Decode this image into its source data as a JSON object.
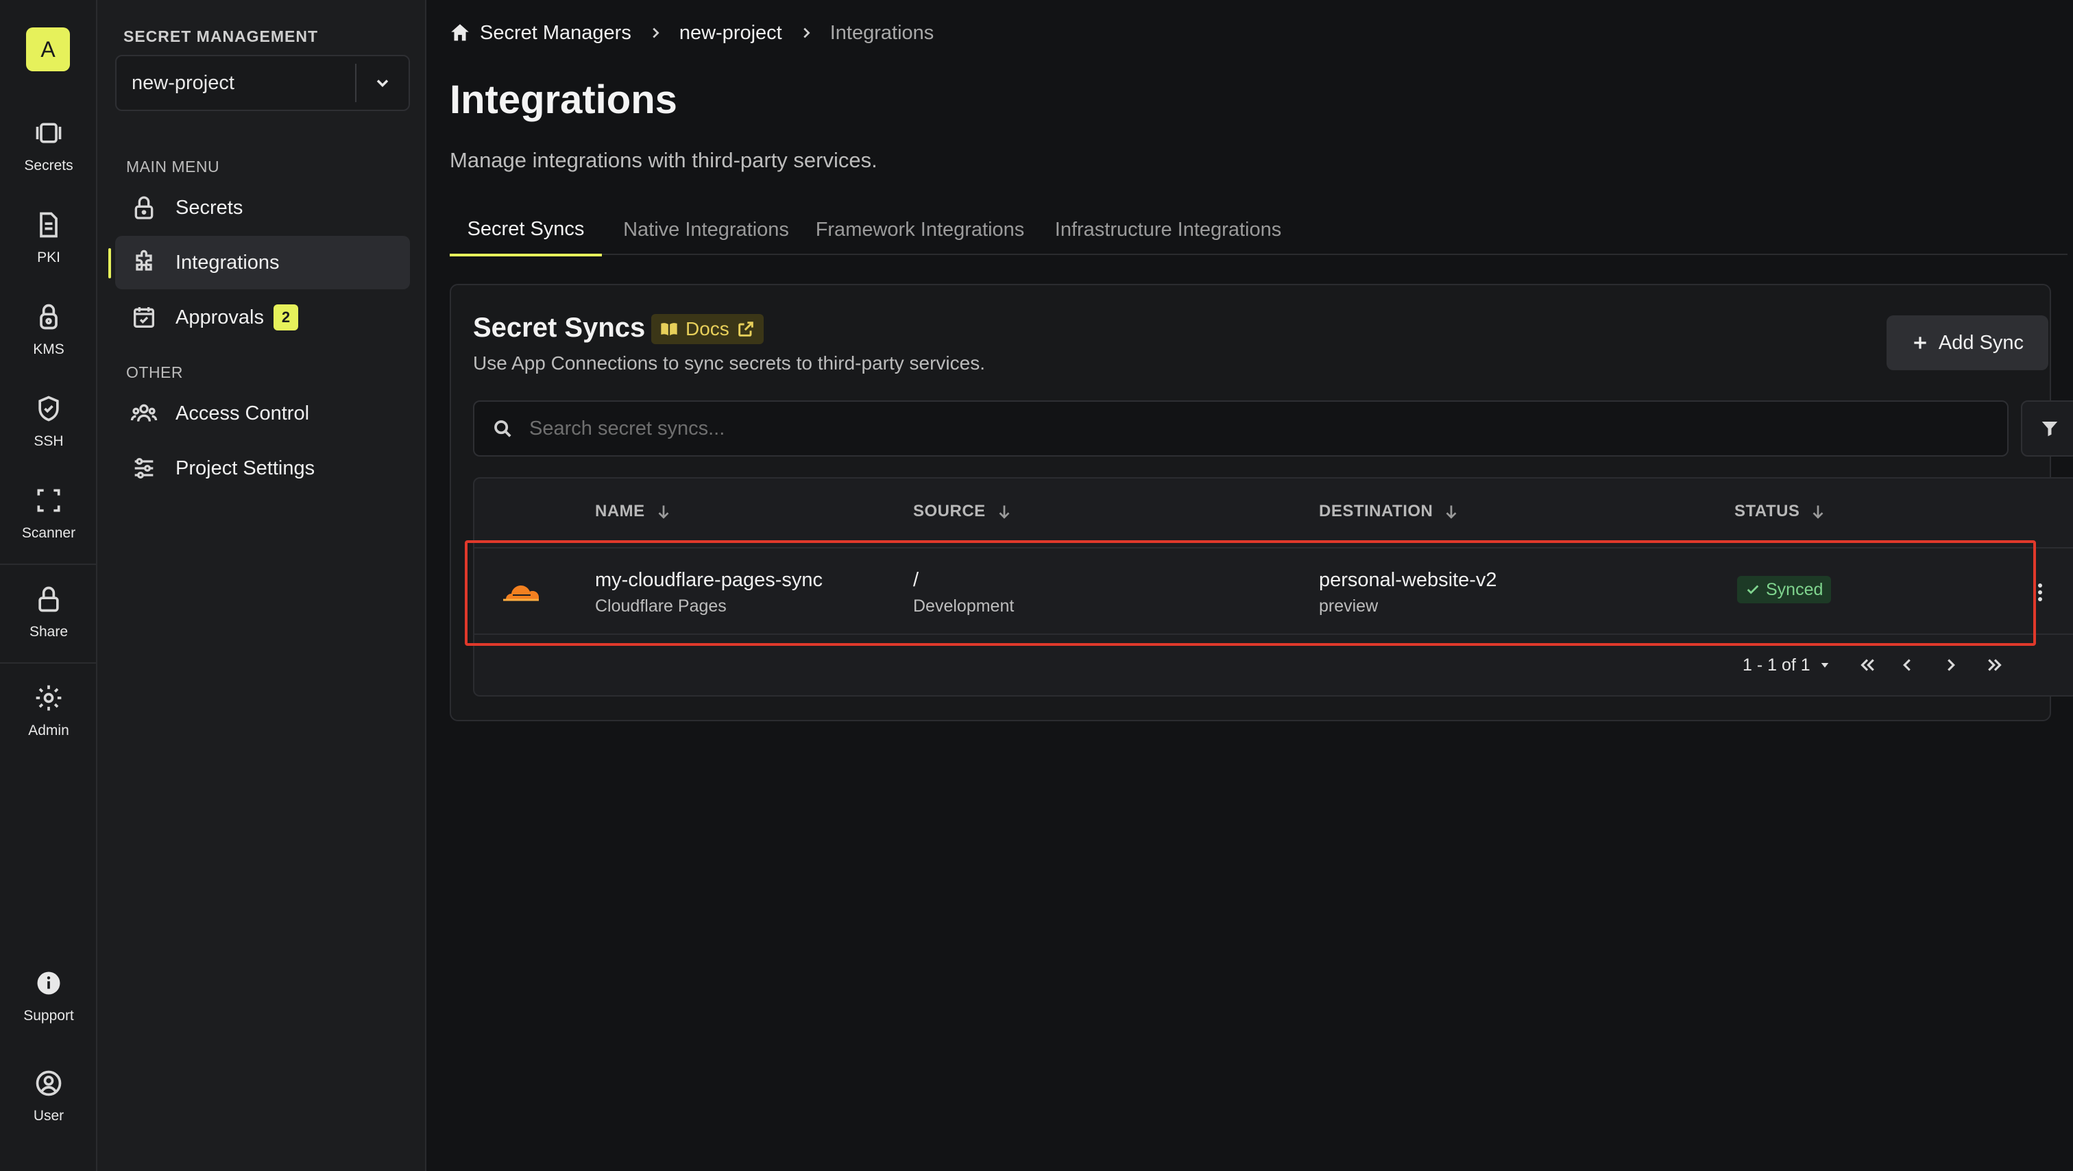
{
  "rail": {
    "org_initial": "A",
    "items": [
      {
        "label": "Secrets",
        "icon": "vault-icon"
      },
      {
        "label": "PKI",
        "icon": "certificate-icon"
      },
      {
        "label": "KMS",
        "icon": "key-lock-icon"
      },
      {
        "label": "SSH",
        "icon": "shield-check-icon"
      },
      {
        "label": "Scanner",
        "icon": "scan-icon"
      },
      {
        "label": "Share",
        "icon": "lock-icon"
      },
      {
        "label": "Admin",
        "icon": "gear-icon"
      },
      {
        "label": "Support",
        "icon": "info-icon"
      },
      {
        "label": "User",
        "icon": "user-circle-icon"
      }
    ]
  },
  "sidebar": {
    "title": "SECRET MANAGEMENT",
    "project": "new-project",
    "main_menu_label": "MAIN MENU",
    "other_label": "OTHER",
    "items": [
      {
        "label": "Secrets",
        "icon": "lock-icon"
      },
      {
        "label": "Integrations",
        "icon": "puzzle-icon",
        "active": true
      },
      {
        "label": "Approvals",
        "icon": "calendar-check-icon",
        "badge": "2"
      },
      {
        "label": "Access Control",
        "icon": "users-icon"
      },
      {
        "label": "Project Settings",
        "icon": "sliders-icon"
      }
    ]
  },
  "breadcrumb": [
    "Secret Managers",
    "new-project",
    "Integrations"
  ],
  "page": {
    "title": "Integrations",
    "subtitle": "Manage integrations with third-party services."
  },
  "tabs": [
    "Secret Syncs",
    "Native Integrations",
    "Framework Integrations",
    "Infrastructure Integrations"
  ],
  "card": {
    "title": "Secret Syncs",
    "docs_label": "Docs",
    "description": "Use App Connections to sync secrets to third-party services.",
    "add_button": "Add Sync",
    "search_placeholder": "Search secret syncs...",
    "columns": [
      "NAME",
      "SOURCE",
      "DESTINATION",
      "STATUS"
    ],
    "rows": [
      {
        "name": "my-cloudflare-pages-sync",
        "service": "Cloudflare Pages",
        "source_path": "/",
        "source_env": "Development",
        "destination": "personal-website-v2",
        "destination_env": "preview",
        "status": "Synced"
      }
    ],
    "pagination": "1 - 1 of 1"
  },
  "colors": {
    "accent": "#e6f15b",
    "highlight": "#e0392b",
    "status_synced": "#7fd48e",
    "cloudflare": "#f38020"
  }
}
